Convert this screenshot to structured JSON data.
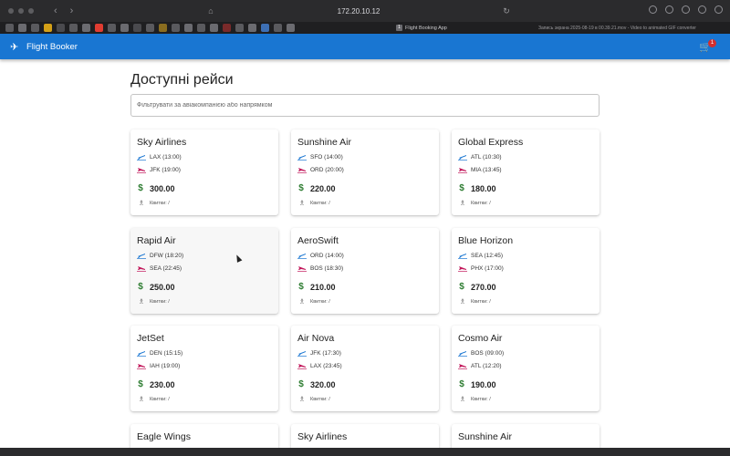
{
  "browser": {
    "address": "172.20.10.12",
    "active_tab": {
      "number": "1",
      "title": "Flight Booking App"
    },
    "other_tab_title": "Запись экрана 2025-08-19 в 00.39.21.mov - Video to animated GIF converter"
  },
  "app": {
    "title": "Flight Booker",
    "cart_count": "1",
    "colors": {
      "primary": "#1976d2",
      "badge": "#d32f2f",
      "price_icon": "#2e7d32",
      "departure_icon": "#1976d2",
      "arrival_icon": "#c2185b"
    }
  },
  "page": {
    "title": "Доступні рейси",
    "filter_placeholder": "Фільтрувати за авіакомпанією або напрямком"
  },
  "flights": [
    {
      "airline": "Sky Airlines",
      "departure": "LAX (13:00)",
      "arrival": "JFK (19:00)",
      "price": "300.00",
      "tickets": "Квитки: /"
    },
    {
      "airline": "Sunshine Air",
      "departure": "SFO (14:00)",
      "arrival": "ORD (20:00)",
      "price": "220.00",
      "tickets": "Квитки: /"
    },
    {
      "airline": "Global Express",
      "departure": "ATL (10:30)",
      "arrival": "MIA (13:45)",
      "price": "180.00",
      "tickets": "Квитки: /"
    },
    {
      "airline": "Rapid Air",
      "departure": "DFW (18:20)",
      "arrival": "SEA (22:45)",
      "price": "250.00",
      "tickets": "Квитки: /"
    },
    {
      "airline": "AeroSwift",
      "departure": "ORD (14:00)",
      "arrival": "BOS (18:30)",
      "price": "210.00",
      "tickets": "Квитки: /"
    },
    {
      "airline": "Blue Horizon",
      "departure": "SEA (12:45)",
      "arrival": "PHX (17:00)",
      "price": "270.00",
      "tickets": "Квитки: /"
    },
    {
      "airline": "JetSet",
      "departure": "DEN (15:15)",
      "arrival": "IAH (19:00)",
      "price": "230.00",
      "tickets": "Квитки: /"
    },
    {
      "airline": "Air Nova",
      "departure": "JFK (17:30)",
      "arrival": "LAX (23:45)",
      "price": "320.00",
      "tickets": "Квитки: /"
    },
    {
      "airline": "Cosmo Air",
      "departure": "BOS (09:00)",
      "arrival": "ATL (12:20)",
      "price": "190.00",
      "tickets": "Квитки: /"
    },
    {
      "airline": "Eagle Wings"
    },
    {
      "airline": "Sky Airlines"
    },
    {
      "airline": "Sunshine Air"
    }
  ]
}
